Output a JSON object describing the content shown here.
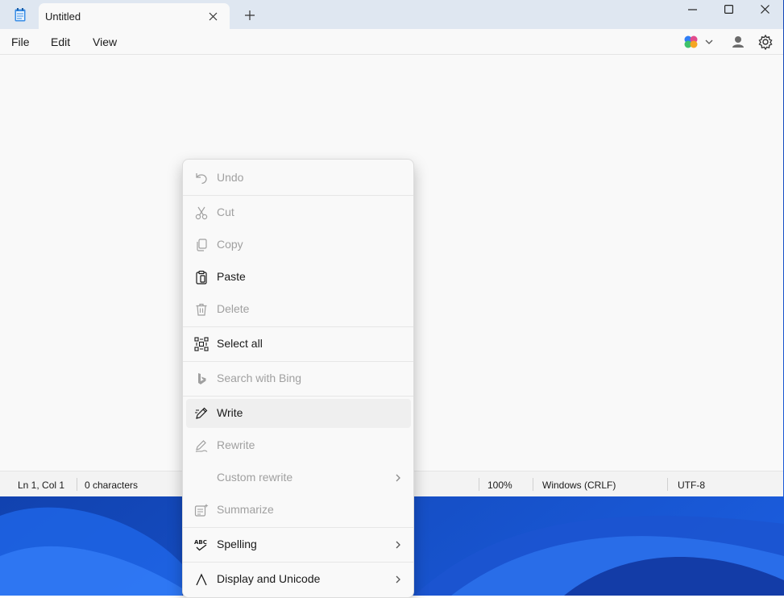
{
  "tab": {
    "title": "Untitled"
  },
  "menubar": {
    "file": "File",
    "edit": "Edit",
    "view": "View"
  },
  "status": {
    "position": "Ln 1, Col 1",
    "characters": "0 characters",
    "zoom": "100%",
    "line_ending": "Windows (CRLF)",
    "encoding": "UTF-8"
  },
  "context_menu": {
    "undo": "Undo",
    "cut": "Cut",
    "copy": "Copy",
    "paste": "Paste",
    "delete": "Delete",
    "select_all": "Select all",
    "search_bing": "Search with Bing",
    "write": "Write",
    "rewrite": "Rewrite",
    "custom_rewrite": "Custom rewrite",
    "summarize": "Summarize",
    "spelling": "Spelling",
    "display_unicode": "Display and Unicode"
  },
  "colors": {
    "titlebar": "#dfe7f1",
    "editor": "#f9f9f9",
    "desktop": "#0b3aa8",
    "disabled_text": "#a0a0a0"
  }
}
